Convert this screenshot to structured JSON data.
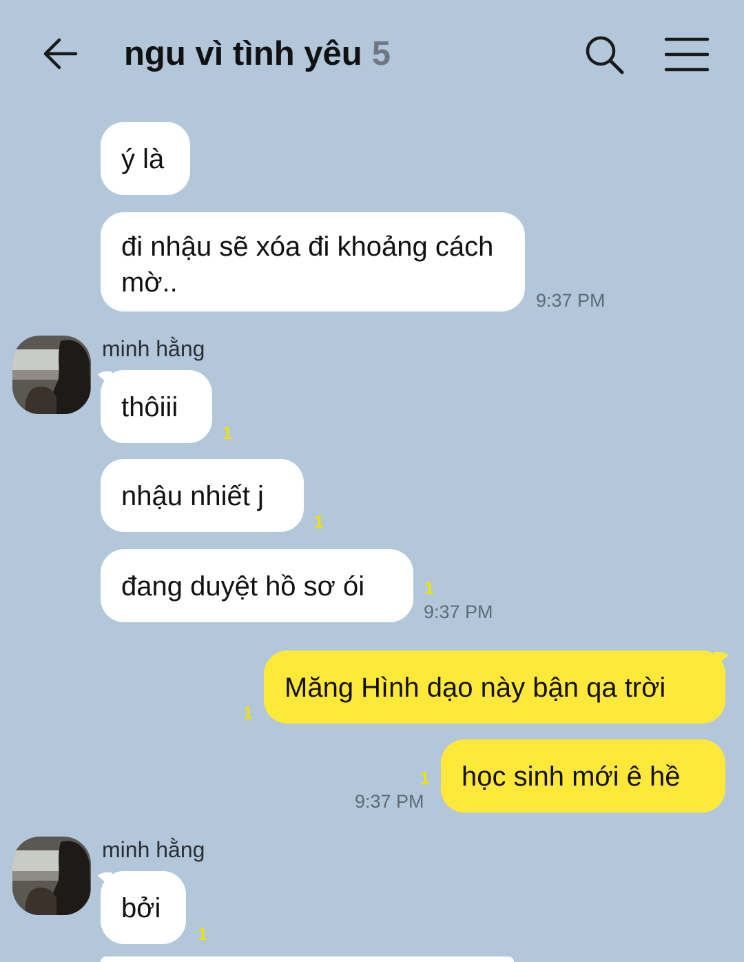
{
  "header": {
    "title": "ngu vì tình yêu",
    "member_count": "5",
    "icons": [
      "back-arrow-icon",
      "search-icon",
      "hamburger-menu-icon"
    ]
  },
  "colors": {
    "background": "#b2c7da",
    "incoming_bubble": "#ffffff",
    "outgoing_bubble": "#fee93a",
    "unread_counter": "#f2e000"
  },
  "messages": [
    {
      "side": "incoming",
      "text": "ý là"
    },
    {
      "side": "incoming",
      "text": "đi nhậu sẽ xóa đi khoảng cách mờ..",
      "time": "9:37 PM"
    },
    {
      "side": "incoming",
      "sender": "minh hằng",
      "text": "thôiii",
      "unread": "1"
    },
    {
      "side": "incoming",
      "text": "nhậu nhiết j",
      "unread": "1"
    },
    {
      "side": "incoming",
      "text": "đang duyệt hồ sơ ói",
      "unread": "1",
      "time": "9:37 PM"
    },
    {
      "side": "outgoing",
      "text": "Măng Hình dạo này bận qa trời",
      "unread": "1"
    },
    {
      "side": "outgoing",
      "text": "học sinh mới ê hề",
      "unread": "1",
      "time": "9:37 PM"
    },
    {
      "side": "incoming",
      "sender": "minh hằng",
      "text": "bởi",
      "unread": "1"
    }
  ]
}
